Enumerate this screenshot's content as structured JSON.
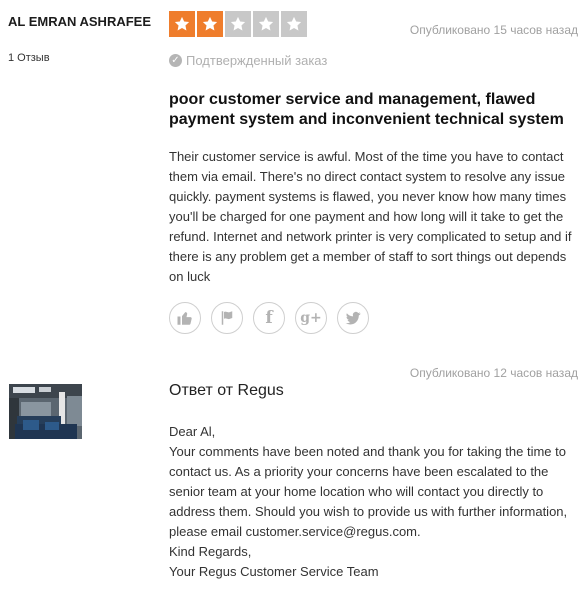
{
  "reviewer": {
    "name": "AL EMRAN ASHRAFEE",
    "reviews_count": "1 Отзыв"
  },
  "review": {
    "rating": 2,
    "max_rating": 5,
    "published": "Опубликовано 15 часов назад",
    "verified_label": "Подтвержденный заказ",
    "title": "poor customer service and management, flawed payment system and inconvenient technical system",
    "body": "Their customer service is awful. Most of the time you have to contact them via email. There's no direct contact system to resolve any issue quickly. payment systems is flawed, you never know how many times you'll be charged for one payment and how long will it take to get the refund. Internet and network printer is very complicated to setup and if there is any problem get a member of staff to sort things out depends on luck",
    "actions": [
      {
        "icon": "thumbs-up-icon"
      },
      {
        "icon": "flag-icon"
      },
      {
        "icon": "facebook-icon",
        "glyph": "f"
      },
      {
        "icon": "google-plus-icon",
        "glyph": "g+"
      },
      {
        "icon": "twitter-icon"
      }
    ]
  },
  "reply": {
    "published": "Опубликовано 12 часов назад",
    "title": "Ответ от Regus",
    "body": "Dear Al,\nYour comments have been noted and thank you for taking the time to contact us. As a priority your concerns have been escalated to the senior team at your home location who will contact you directly to address them. Should you wish to provide us with further information, please email customer.service@regus.com.\nKind Regards,\nYour Regus Customer Service Team"
  },
  "colors": {
    "star_active": "#ef7d2c",
    "star_inactive": "#c8c8c8",
    "muted_text": "#a0a0a0"
  }
}
